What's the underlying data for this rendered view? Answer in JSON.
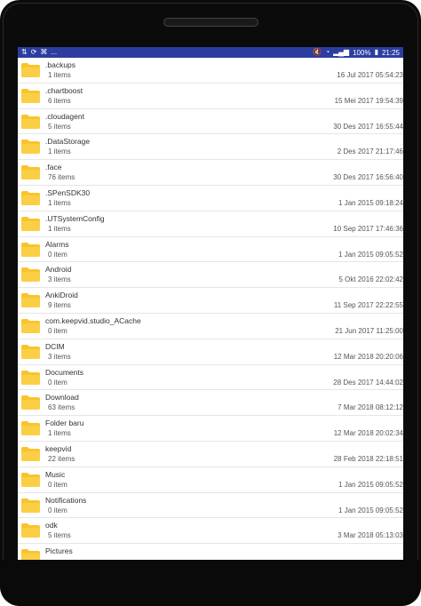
{
  "status_bar": {
    "left_icons": [
      "network-icon",
      "sync-icon",
      "cast-icon",
      "more-notifications-icon"
    ],
    "left_text": "...",
    "battery": "100%",
    "time": "21:25",
    "colors": {
      "background": "#2b3ea0",
      "text": "#ffffff"
    }
  },
  "folder_color": "#f9c42b",
  "files": [
    {
      "name": ".backups",
      "count": "1 items",
      "date": "16 Jul 2017 05:54:23"
    },
    {
      "name": ".chartboost",
      "count": "6 items",
      "date": "15 Mei 2017 19:54:39"
    },
    {
      "name": ".cloudagent",
      "count": "5 items",
      "date": "30 Des 2017 16:55:44"
    },
    {
      "name": ".DataStorage",
      "count": "1 items",
      "date": "2 Des 2017 21:17:46"
    },
    {
      "name": ".face",
      "count": "76 items",
      "date": "30 Des 2017 16:56:40"
    },
    {
      "name": ".SPenSDK30",
      "count": "1 items",
      "date": "1 Jan 2015 09:18:24"
    },
    {
      "name": ".UTSystemConfig",
      "count": "1 items",
      "date": "10 Sep 2017 17:46:36"
    },
    {
      "name": "Alarms",
      "count": "0 item",
      "date": "1 Jan 2015 09:05:52"
    },
    {
      "name": "Android",
      "count": "3 items",
      "date": "5 Okt 2016 22:02:42"
    },
    {
      "name": "AnkiDroid",
      "count": "9 items",
      "date": "11 Sep 2017 22:22:55"
    },
    {
      "name": "com.keepvid.studio_ACache",
      "count": "0 item",
      "date": "21 Jun 2017 11:25:00"
    },
    {
      "name": "DCIM",
      "count": "3 items",
      "date": "12 Mar 2018 20:20:06"
    },
    {
      "name": "Documents",
      "count": "0 item",
      "date": "28 Des 2017 14:44:02"
    },
    {
      "name": "Download",
      "count": "63 items",
      "date": "7 Mar 2018 08:12:12"
    },
    {
      "name": "Folder baru",
      "count": "1 items",
      "date": "12 Mar 2018 20:02:34"
    },
    {
      "name": "keepvid",
      "count": "22 items",
      "date": "28 Feb 2018 22:18:51"
    },
    {
      "name": "Music",
      "count": "0 item",
      "date": "1 Jan 2015 09:05:52"
    },
    {
      "name": "Notifications",
      "count": "0 item",
      "date": "1 Jan 2015 09:05:52"
    },
    {
      "name": "odk",
      "count": "5 items",
      "date": "3 Mar 2018 05:13:03"
    },
    {
      "name": "Pictures",
      "count": "",
      "date": ""
    }
  ]
}
